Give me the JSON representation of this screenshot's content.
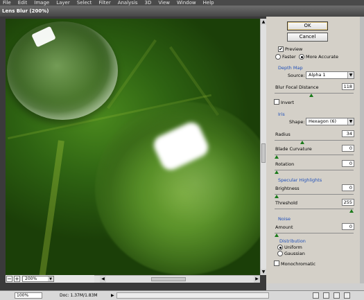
{
  "menu": [
    "File",
    "Edit",
    "Image",
    "Layer",
    "Select",
    "Filter",
    "Analysis",
    "3D",
    "View",
    "Window",
    "Help"
  ],
  "dialog": {
    "title": "Lens Blur (200%)"
  },
  "buttons": {
    "ok": "OK",
    "cancel": "Cancel"
  },
  "preview": {
    "checked": true,
    "label": "Preview"
  },
  "quality": {
    "faster": "Faster",
    "more_accurate": "More Accurate",
    "selected": "More Accurate"
  },
  "depth_map": {
    "heading": "Depth Map",
    "source_label": "Source:",
    "source_value": "Alpha 1",
    "blur_focal_label": "Blur Focal Distance",
    "blur_focal_value": "118",
    "blur_focal_slider": 0.46,
    "invert_label": "Invert",
    "invert_checked": false
  },
  "iris": {
    "heading": "Iris",
    "shape_label": "Shape:",
    "shape_value": "Hexagon (6)",
    "radius_label": "Radius",
    "radius_value": "34",
    "radius_slider": 0.34,
    "blade_label": "Blade Curvature",
    "blade_value": "0",
    "blade_slider": 0,
    "rotation_label": "Rotation",
    "rotation_value": "0",
    "rotation_slider": 0
  },
  "specular": {
    "heading": "Specular Highlights",
    "brightness_label": "Brightness",
    "brightness_value": "0",
    "brightness_slider": 0,
    "threshold_label": "Threshold",
    "threshold_value": "255",
    "threshold_slider": 1
  },
  "noise": {
    "heading": "Noise",
    "amount_label": "Amount",
    "amount_value": "0",
    "amount_slider": 0,
    "distribution_heading": "Distribution",
    "uniform": "Uniform",
    "gaussian": "Gaussian",
    "selected": "Uniform",
    "mono_label": "Monochromatic",
    "mono_checked": false
  },
  "zoom": {
    "value": "200%",
    "minus": "−",
    "plus": "+"
  },
  "status": {
    "zoom": "100%",
    "doc": "Doc: 1.37M/1.83M"
  },
  "colors": {
    "accent_heading": "#1f4fb8",
    "slider_knob": "#1a7a1a"
  }
}
